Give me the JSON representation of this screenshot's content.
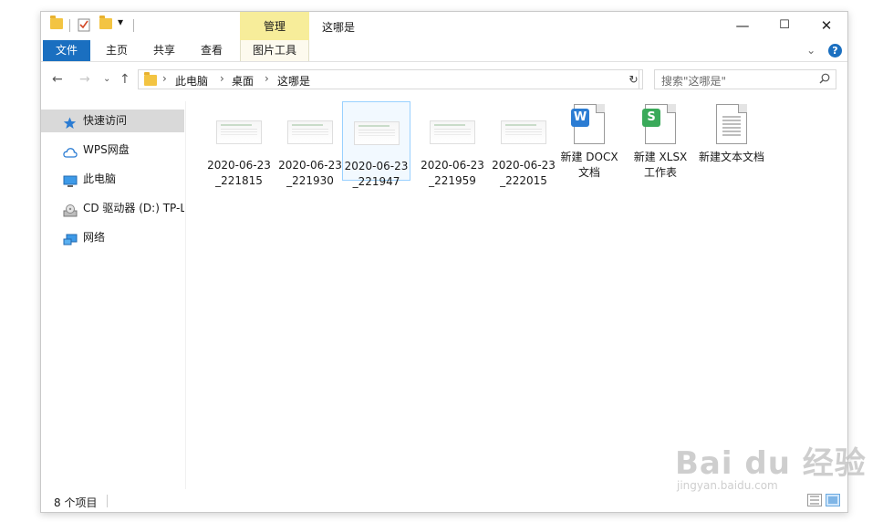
{
  "title_bar": {
    "manage_tab": "管理",
    "title": "这哪是",
    "minimize": "—",
    "maximize": "☐",
    "close": "✕"
  },
  "ribbon": {
    "tabs": [
      "文件",
      "主页",
      "共享",
      "查看",
      "图片工具"
    ],
    "expand": "⌄",
    "help": "?"
  },
  "address": {
    "back": "←",
    "forward": "→",
    "recent": "⌄",
    "up": "↑",
    "breadcrumb": [
      "此电脑",
      "桌面",
      "这哪是"
    ],
    "separator": "›",
    "dropdown": "⌄",
    "refresh": "↻"
  },
  "search": {
    "placeholder": "搜索\"这哪是\"",
    "icon": "search-icon"
  },
  "nav": {
    "items": [
      {
        "label": "快速访问",
        "icon": "star-icon"
      },
      {
        "label": "WPS网盘",
        "icon": "cloud-icon"
      },
      {
        "label": "此电脑",
        "icon": "computer-icon"
      },
      {
        "label": "CD 驱动器 (D:) TP-L",
        "icon": "cd-drive-icon"
      },
      {
        "label": "网络",
        "icon": "network-icon"
      }
    ]
  },
  "files": [
    {
      "name": "2020-06-23_221815",
      "type": "image",
      "selected": false
    },
    {
      "name": "2020-06-23_221930",
      "type": "image",
      "selected": false
    },
    {
      "name": "2020-06-23_221947",
      "type": "image",
      "selected": true
    },
    {
      "name": "2020-06-23_221959",
      "type": "image",
      "selected": false
    },
    {
      "name": "2020-06-23_222015",
      "type": "image",
      "selected": false
    },
    {
      "name": "新建 DOCX 文档",
      "type": "wps-writer",
      "badge": "W",
      "badge_color": "#2b7cd3"
    },
    {
      "name": "新建 XLSX 工作表",
      "type": "wps-sheet",
      "badge": "S",
      "badge_color": "#3aaa5a"
    },
    {
      "name": "新建文本文档",
      "type": "text"
    }
  ],
  "status": {
    "count": "8 个项目"
  },
  "watermark": {
    "main": "Bai du 经验",
    "sub": "jingyan.baidu.com"
  },
  "colors": {
    "accent": "#1a6fc0",
    "manage_tab": "#f7ed9a",
    "selection_border": "#99d1ff",
    "selection_fill": "#f2f9ff",
    "nav_selected": "#d9d9d9"
  }
}
